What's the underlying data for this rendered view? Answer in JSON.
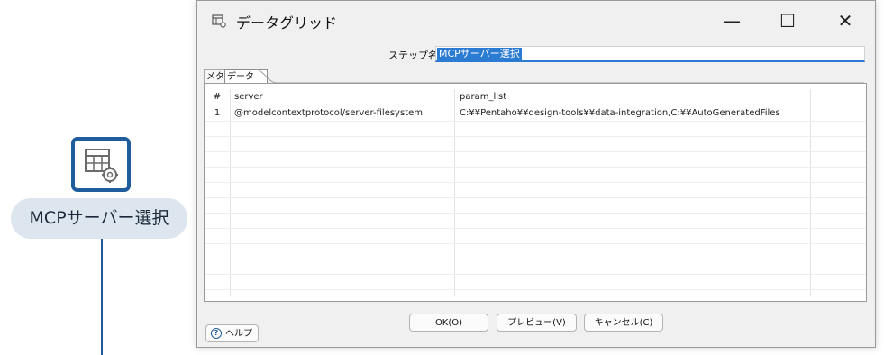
{
  "canvas": {
    "step_label": "MCPサーバー選択"
  },
  "dialog": {
    "title": "データグリッド",
    "window_controls": {
      "minimize": "—",
      "maximize": "☐",
      "close": "✕"
    },
    "step_name_label": "ステップ名",
    "step_name_value": "MCPサーバー選択",
    "tabs": [
      {
        "label": "メタ"
      },
      {
        "label": "データ"
      }
    ],
    "grid": {
      "columns": [
        "#",
        "server",
        "param_list"
      ],
      "rows": [
        {
          "num": "1",
          "server": "@modelcontextprotocol/server-filesystem",
          "param_list": "C:¥¥Pentaho¥¥design-tools¥¥data-integration,C:¥¥AutoGeneratedFiles"
        }
      ]
    },
    "buttons": {
      "ok": "OK(O)",
      "preview": "プレビュー(V)",
      "cancel": "キャンセル(C)",
      "help": "ヘルプ"
    }
  },
  "icons": {
    "step_icon": "datagrid-gear-icon",
    "title_icon": "datagrid-icon",
    "help_icon": "help-circle-icon"
  },
  "colors": {
    "accent": "#1f5c9c",
    "selection": "#2b7bd2",
    "step_label_bg": "#dde6ef"
  }
}
